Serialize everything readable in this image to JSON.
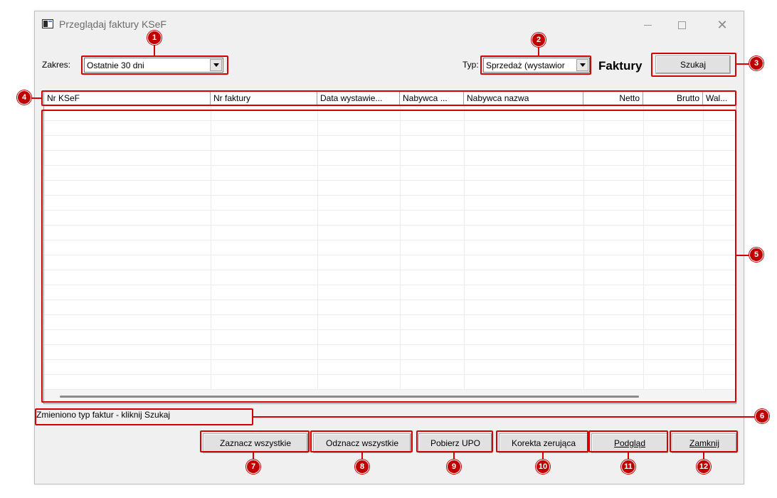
{
  "window": {
    "title": "Przeglądaj faktury KSeF",
    "minimize_icon": "minimize-icon",
    "maximize_icon": "maximize-icon",
    "close_glyph": "✕"
  },
  "filters": {
    "zakres_label": "Zakres:",
    "zakres_value": "Ostatnie 30 dni",
    "typ_label": "Typ:",
    "typ_value": "Sprzedaż (wystawior",
    "faktury_label": "Faktury",
    "search_button": "Szukaj"
  },
  "grid": {
    "columns": [
      "Nr KSeF",
      "Nr faktury",
      "Data wystawie...",
      "Nabywca ...",
      "Nabywca nazwa",
      "Netto",
      "Brutto",
      "Wal..."
    ],
    "rows": []
  },
  "status_text": "Zmieniono typ faktur - kliknij Szukaj",
  "buttons": {
    "select_all": "Zaznacz wszystkie",
    "deselect_all": "Odznacz wszystkie",
    "get_upo": "Pobierz UPO",
    "zero_correction": "Korekta zerująca",
    "preview": "Podgląd",
    "close": "Zamknij"
  },
  "annotations": [
    "1",
    "2",
    "3",
    "4",
    "5",
    "6",
    "7",
    "8",
    "9",
    "10",
    "11",
    "12"
  ],
  "colors": {
    "annotation": "#d40000",
    "badge": "#c00000",
    "window_bg": "#f0f0f0"
  }
}
